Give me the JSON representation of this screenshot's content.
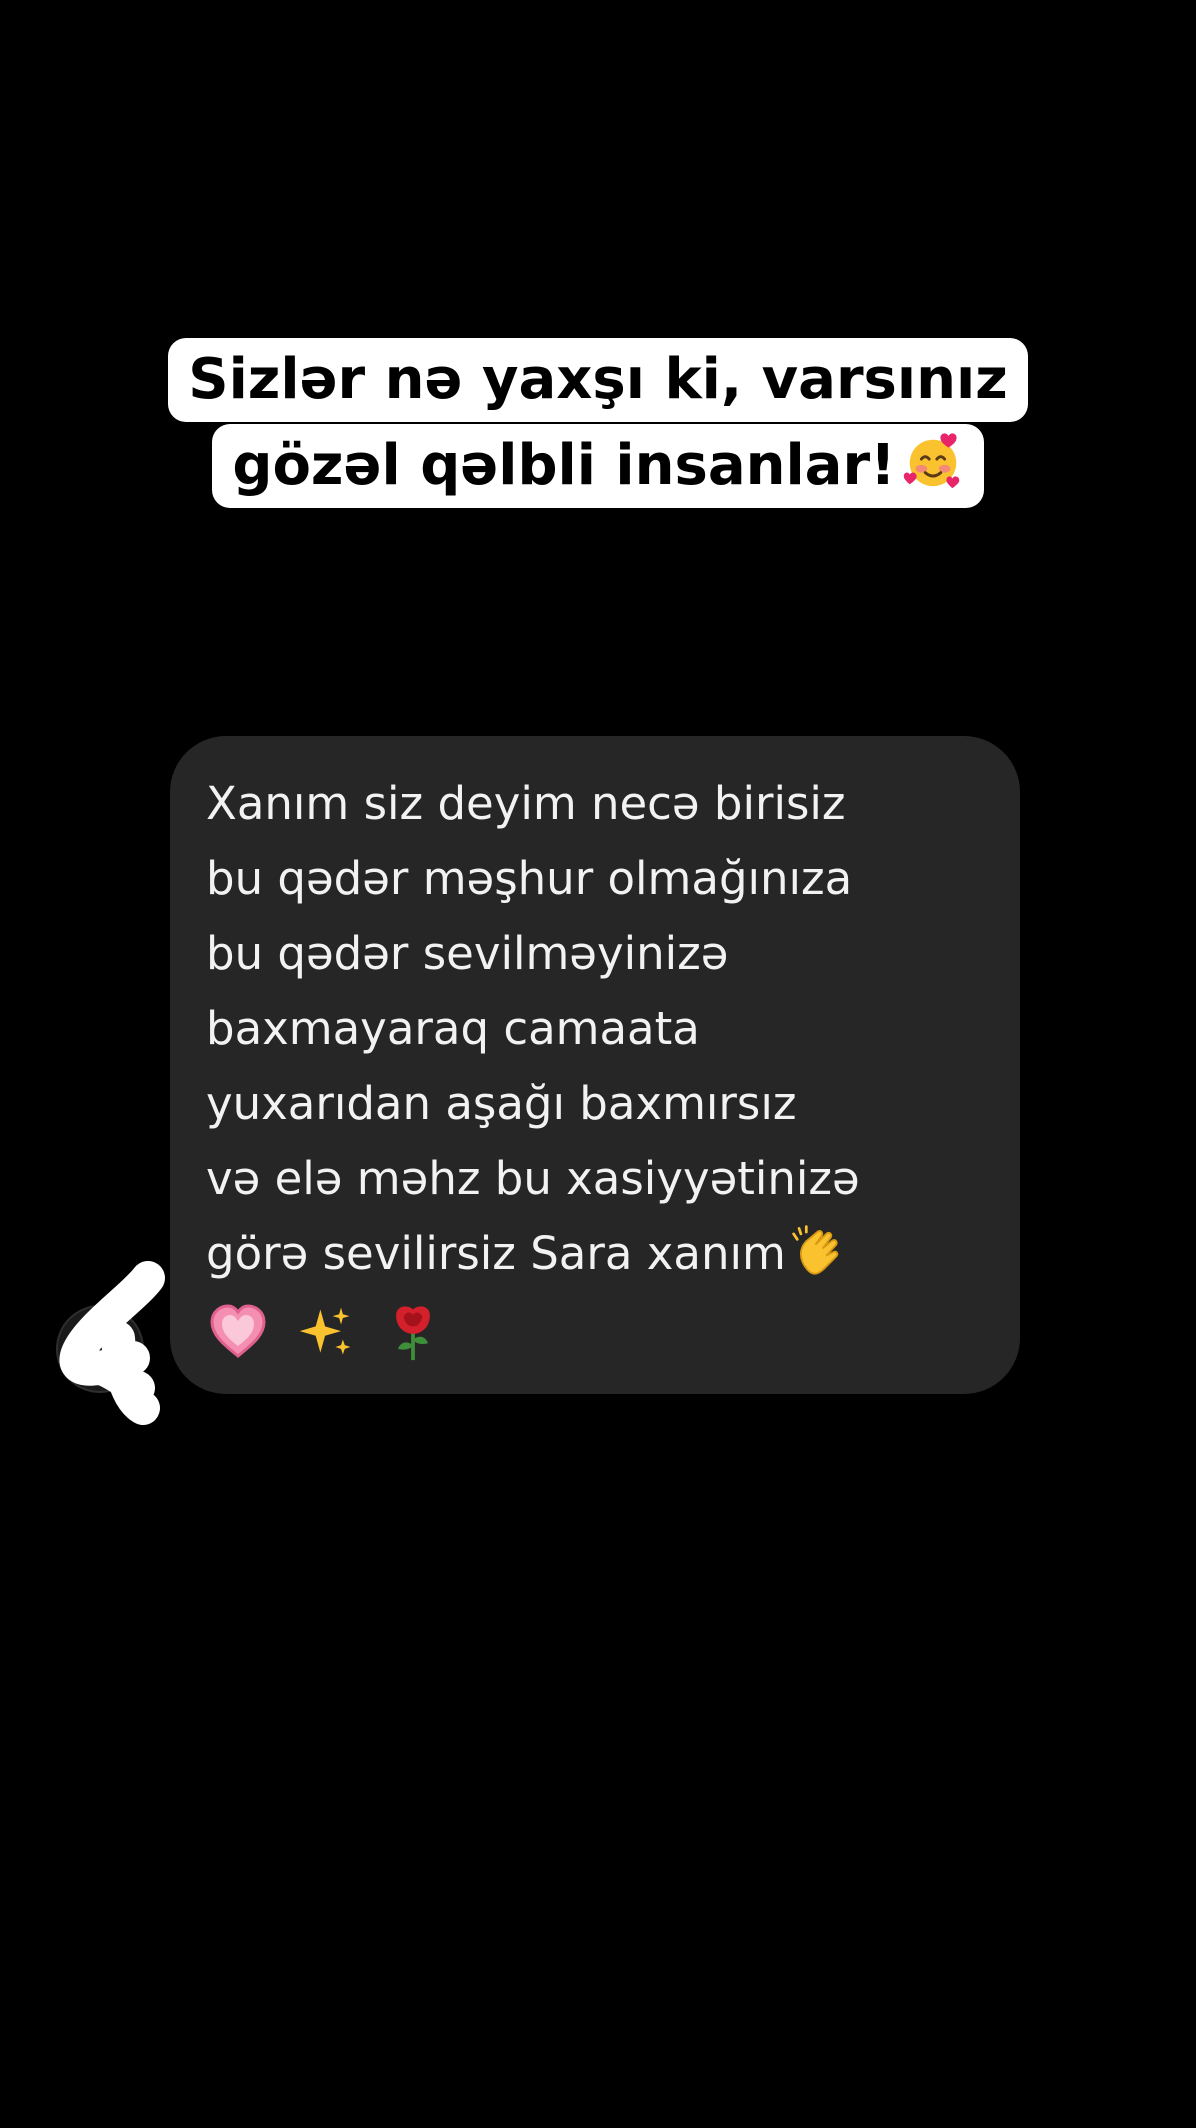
{
  "caption": {
    "line1": "Sizlər nə yaxşı ki, varsınız",
    "line2": "gözəl qəlbli insanlar!",
    "emoji": "smiling-face-with-hearts-icon"
  },
  "message": {
    "lines": [
      "Xanım siz deyim necə birisiz",
      "bu qədər məşhur olmağınıza",
      "bu qədər sevilməyinizə",
      "baxmayaraq camaata",
      "yuxarıdan aşağı baxmırsız",
      "və elə məhz bu xasiyyətinizə",
      "görə sevilirsiz Sara xanım"
    ],
    "emojis": [
      "clapping-hands-icon",
      "pink-heart-icon",
      "sparkles-icon",
      "rose-icon"
    ]
  },
  "colors": {
    "background": "#000000",
    "bubble": "#262626",
    "message_text": "#f2f2f2",
    "caption_bg": "#ffffff",
    "caption_text": "#000000"
  }
}
